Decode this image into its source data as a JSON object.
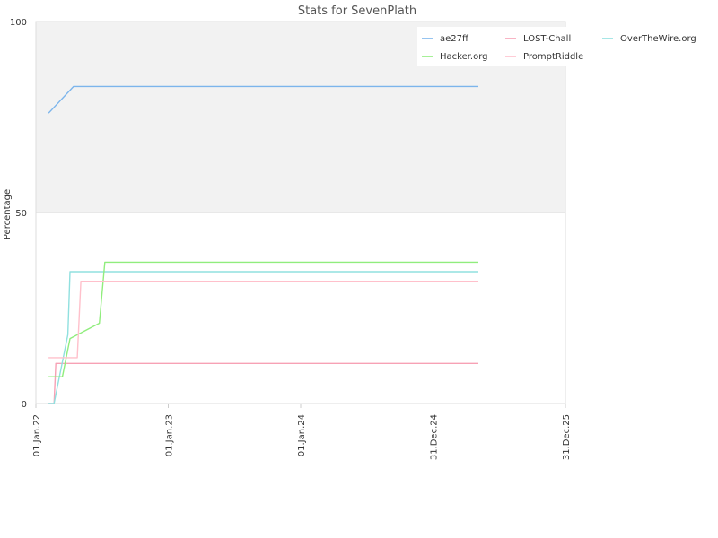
{
  "chart_data": {
    "type": "line",
    "title": "Stats for SevenPlath",
    "xlabel": "",
    "ylabel": "Percentage",
    "ylim": [
      0,
      100
    ],
    "y_ticks": [
      0,
      50,
      100
    ],
    "xlim": [
      "2022-01-01",
      "2025-12-31"
    ],
    "x_ticks": [
      {
        "date": "2022-01-01",
        "label": "01.Jan.22"
      },
      {
        "date": "2023-01-01",
        "label": "01.Jan.23"
      },
      {
        "date": "2024-01-01",
        "label": "01.Jan.24"
      },
      {
        "date": "2024-12-31",
        "label": "31.Dec.24"
      },
      {
        "date": "2025-12-31",
        "label": "31.Dec.25"
      }
    ],
    "upper_band": {
      "from": 50,
      "to": 100,
      "color": "#f2f2f2"
    },
    "legend_position": "top-right",
    "series": [
      {
        "name": "ae27ff",
        "color": "#7cb5ec",
        "points": [
          [
            "2022-02-05",
            76
          ],
          [
            "2022-04-15",
            83
          ],
          [
            "2025-05-05",
            83
          ]
        ]
      },
      {
        "name": "LOST-Chall",
        "color": "#f7a1b5",
        "points": [
          [
            "2022-02-05",
            0
          ],
          [
            "2022-02-20",
            0
          ],
          [
            "2022-02-25",
            10.5
          ],
          [
            "2025-05-05",
            10.5
          ]
        ]
      },
      {
        "name": "OverTheWire.org",
        "color": "#90e0df",
        "points": [
          [
            "2022-02-05",
            0
          ],
          [
            "2022-02-20",
            0
          ],
          [
            "2022-03-30",
            18
          ],
          [
            "2022-04-05",
            34.5
          ],
          [
            "2025-05-05",
            34.5
          ]
        ]
      },
      {
        "name": "Hacker.org",
        "color": "#90ed7d",
        "points": [
          [
            "2022-02-05",
            7
          ],
          [
            "2022-03-15",
            7
          ],
          [
            "2022-04-05",
            17
          ],
          [
            "2022-06-25",
            21
          ],
          [
            "2022-07-10",
            37
          ],
          [
            "2025-05-05",
            37
          ]
        ]
      },
      {
        "name": "PromptRiddle",
        "color": "#ffc0cb",
        "points": [
          [
            "2022-02-05",
            12
          ],
          [
            "2022-04-25",
            12
          ],
          [
            "2022-05-05",
            32
          ],
          [
            "2025-05-05",
            32
          ]
        ]
      }
    ]
  }
}
